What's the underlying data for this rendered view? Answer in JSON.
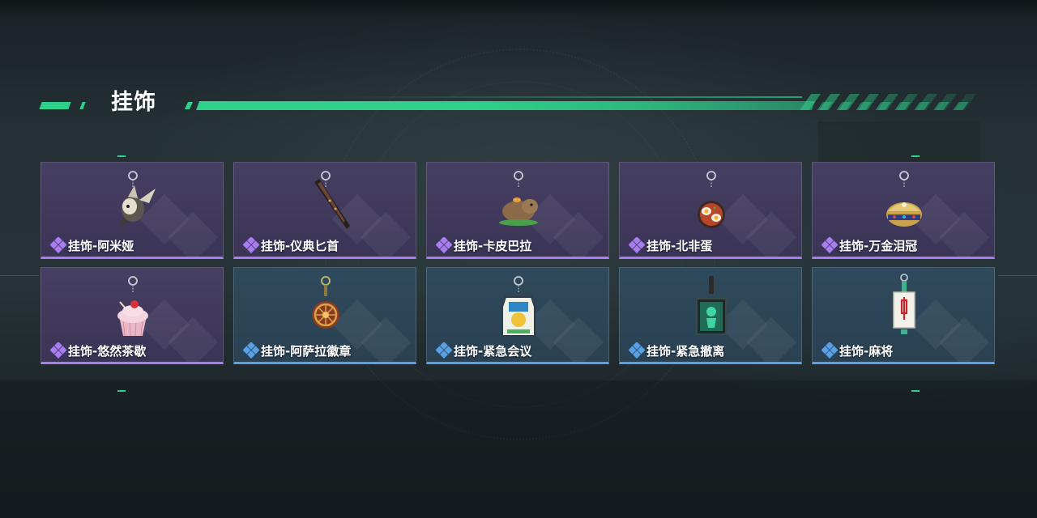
{
  "section": {
    "title": "挂饰"
  },
  "colors": {
    "accent_green": "#2fd08a",
    "rarity_purple": "#a77df0",
    "rarity_blue": "#5aa0e6"
  },
  "items": [
    {
      "name": "挂饰-阿米娅",
      "rarity": "purple",
      "icon": "amiya-plush-charm-icon"
    },
    {
      "name": "挂饰-仪典匕首",
      "rarity": "purple",
      "icon": "ceremonial-dagger-charm-icon"
    },
    {
      "name": "挂饰-卡皮巴拉",
      "rarity": "purple",
      "icon": "capybara-charm-icon"
    },
    {
      "name": "挂饰-北非蛋",
      "rarity": "purple",
      "icon": "shakshuka-pan-charm-icon"
    },
    {
      "name": "挂饰-万金泪冠",
      "rarity": "purple",
      "icon": "jeweled-crown-charm-icon"
    },
    {
      "name": "挂饰-悠然茶歇",
      "rarity": "purple",
      "icon": "cupcake-charm-icon"
    },
    {
      "name": "挂饰-阿萨拉徽章",
      "rarity": "blue",
      "icon": "asala-badge-charm-icon"
    },
    {
      "name": "挂饰-紧急会议",
      "rarity": "blue",
      "icon": "emergency-meeting-charm-icon"
    },
    {
      "name": "挂饰-紧急撤离",
      "rarity": "blue",
      "icon": "emergency-evac-charm-icon"
    },
    {
      "name": "挂饰-麻将",
      "rarity": "blue",
      "icon": "mahjong-tile-charm-icon"
    }
  ]
}
